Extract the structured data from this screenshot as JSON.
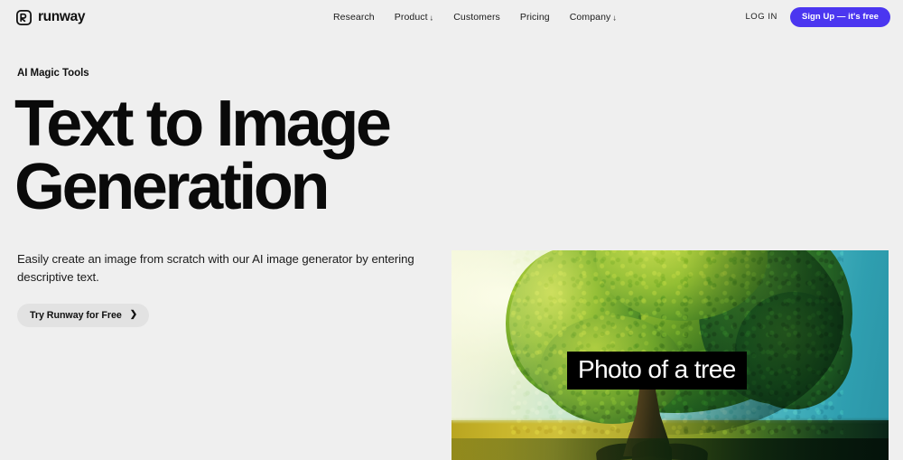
{
  "header": {
    "brand": {
      "name": "runway",
      "logo_icon": "runway-logo-mark"
    },
    "nav": [
      {
        "label": "Research",
        "has_dropdown": false,
        "caret": ""
      },
      {
        "label": "Product",
        "has_dropdown": true,
        "caret": "↓"
      },
      {
        "label": "Customers",
        "has_dropdown": false,
        "caret": ""
      },
      {
        "label": "Pricing",
        "has_dropdown": false,
        "caret": ""
      },
      {
        "label": "Company",
        "has_dropdown": true,
        "caret": "↓"
      }
    ],
    "login_label": "LOG IN",
    "signup_label": "Sign Up — it's free",
    "signup_color": "#4b36f0"
  },
  "hero": {
    "eyebrow": "AI Magic Tools",
    "headline_line1": "Text to Image",
    "headline_line2": "Generation",
    "description": "Easily create an image from scratch with our AI image generator by entering descriptive text.",
    "cta_label": "Try Runway for Free",
    "cta_icon": "chevron-right-icon",
    "cta_bg": "#e2e2e2"
  },
  "media": {
    "alt": "Generated image of a large green tree in a field under a teal sky",
    "caption": "Photo of a tree",
    "caption_bg": "#000000",
    "caption_color": "#ffffff"
  },
  "theme": {
    "page_bg": "#efefef",
    "text_color": "#111111"
  }
}
